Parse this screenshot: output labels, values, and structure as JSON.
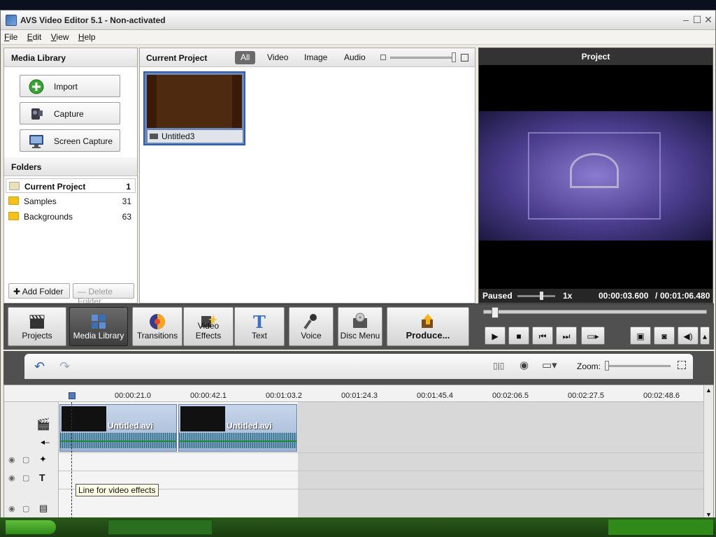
{
  "app": {
    "title": "AVS Video Editor 5.1 - Non-activated",
    "window_controls": {
      "minimize": "–",
      "maximize": "☐",
      "close": "✕"
    }
  },
  "menu": [
    {
      "label": "File",
      "ul": "F",
      "rest": "ile"
    },
    {
      "label": "Edit",
      "ul": "E",
      "rest": "dit"
    },
    {
      "label": "View",
      "ul": "V",
      "rest": "iew"
    },
    {
      "label": "Help",
      "ul": "H",
      "rest": "elp"
    }
  ],
  "media_library": {
    "title": "Media Library",
    "buttons": {
      "import": "Import",
      "capture": "Capture",
      "screen_capture": "Screen Capture"
    },
    "folders_title": "Folders",
    "folders": [
      {
        "name": "Current Project",
        "count": "1"
      },
      {
        "name": "Samples",
        "count": "31"
      },
      {
        "name": "Backgrounds",
        "count": "63"
      }
    ],
    "add_folder": "Add Folder",
    "delete_folder": "Delete Folder"
  },
  "project": {
    "title": "Current Project",
    "filters": [
      "All",
      "Video",
      "Image",
      "Audio"
    ],
    "active_filter": "All",
    "items": [
      {
        "name": "Untitled3"
      }
    ]
  },
  "preview": {
    "title": "Project",
    "status": "Paused",
    "speed": "1x",
    "current_time": "00:00:03.600",
    "separator": "/",
    "total_time": "00:01:06.480"
  },
  "toolbar": {
    "projects": "Projects",
    "media_library": "Media Library",
    "transitions": "Transitions",
    "video_effects": "Video Effects",
    "text": "Text",
    "voice": "Voice",
    "disc_menu": "Disc Menu",
    "produce": "Produce..."
  },
  "timeline": {
    "zoom_label": "Zoom:",
    "ruler_ticks": [
      "00:00:21.0",
      "00:00:42.1",
      "00:01:03.2",
      "00:01:24.3",
      "00:01:45.4",
      "00:02:06.5",
      "00:02:27.5",
      "00:02:48.6"
    ],
    "clips": [
      {
        "name": "Untitled.avi"
      },
      {
        "name": "Untitled.avi"
      }
    ],
    "tooltip": "Line for video effects"
  },
  "colors": {
    "accent": "#2f5da8",
    "toolbar_bg": "#505050",
    "active_tool": "#4a4a4a"
  }
}
